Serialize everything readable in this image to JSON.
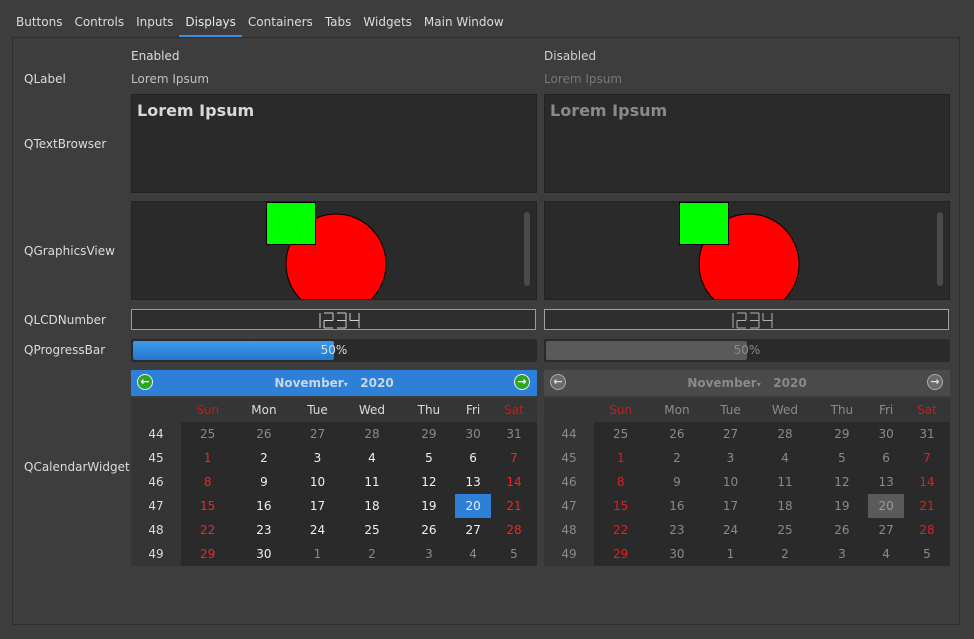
{
  "tabs": [
    "Buttons",
    "Controls",
    "Inputs",
    "Displays",
    "Containers",
    "Tabs",
    "Widgets",
    "Main Window"
  ],
  "active_tab": "Displays",
  "columns": {
    "enabled": "Enabled",
    "disabled": "Disabled"
  },
  "rows": {
    "qlabel": "QLabel",
    "qtextbrowser": "QTextBrowser",
    "qgraphicsview": "QGraphicsView",
    "qlcdnumber": "QLCDNumber",
    "qprogressbar": "QProgressBar",
    "qcalendarwidget": "QCalendarWidget"
  },
  "label_text": "Lorem Ipsum",
  "textbrowser_text": "Lorem Ipsum",
  "lcd_value": "1234",
  "progress": {
    "value": 50,
    "text": "50%"
  },
  "graphics": {
    "square_color": "#00ff00",
    "circle_color": "#ff0000"
  },
  "calendar": {
    "month": "November",
    "year": "2020",
    "weekdays": [
      "Sun",
      "Mon",
      "Tue",
      "Wed",
      "Thu",
      "Fri",
      "Sat"
    ],
    "weeks": [
      {
        "num": "44",
        "days": [
          "25",
          "26",
          "27",
          "28",
          "29",
          "30",
          "31"
        ]
      },
      {
        "num": "45",
        "days": [
          "1",
          "2",
          "3",
          "4",
          "5",
          "6",
          "7"
        ]
      },
      {
        "num": "46",
        "days": [
          "8",
          "9",
          "10",
          "11",
          "12",
          "13",
          "14"
        ]
      },
      {
        "num": "47",
        "days": [
          "15",
          "16",
          "17",
          "18",
          "19",
          "20",
          "21"
        ]
      },
      {
        "num": "48",
        "days": [
          "22",
          "23",
          "24",
          "25",
          "26",
          "27",
          "28"
        ]
      },
      {
        "num": "49",
        "days": [
          "29",
          "30",
          "1",
          "2",
          "3",
          "4",
          "5"
        ]
      }
    ],
    "selected_day": "20",
    "icons": {
      "prev": "arrow-left-icon",
      "next": "arrow-right-icon"
    }
  },
  "colors": {
    "accent": "#2d7fd8",
    "weekend": "#ff2020"
  }
}
